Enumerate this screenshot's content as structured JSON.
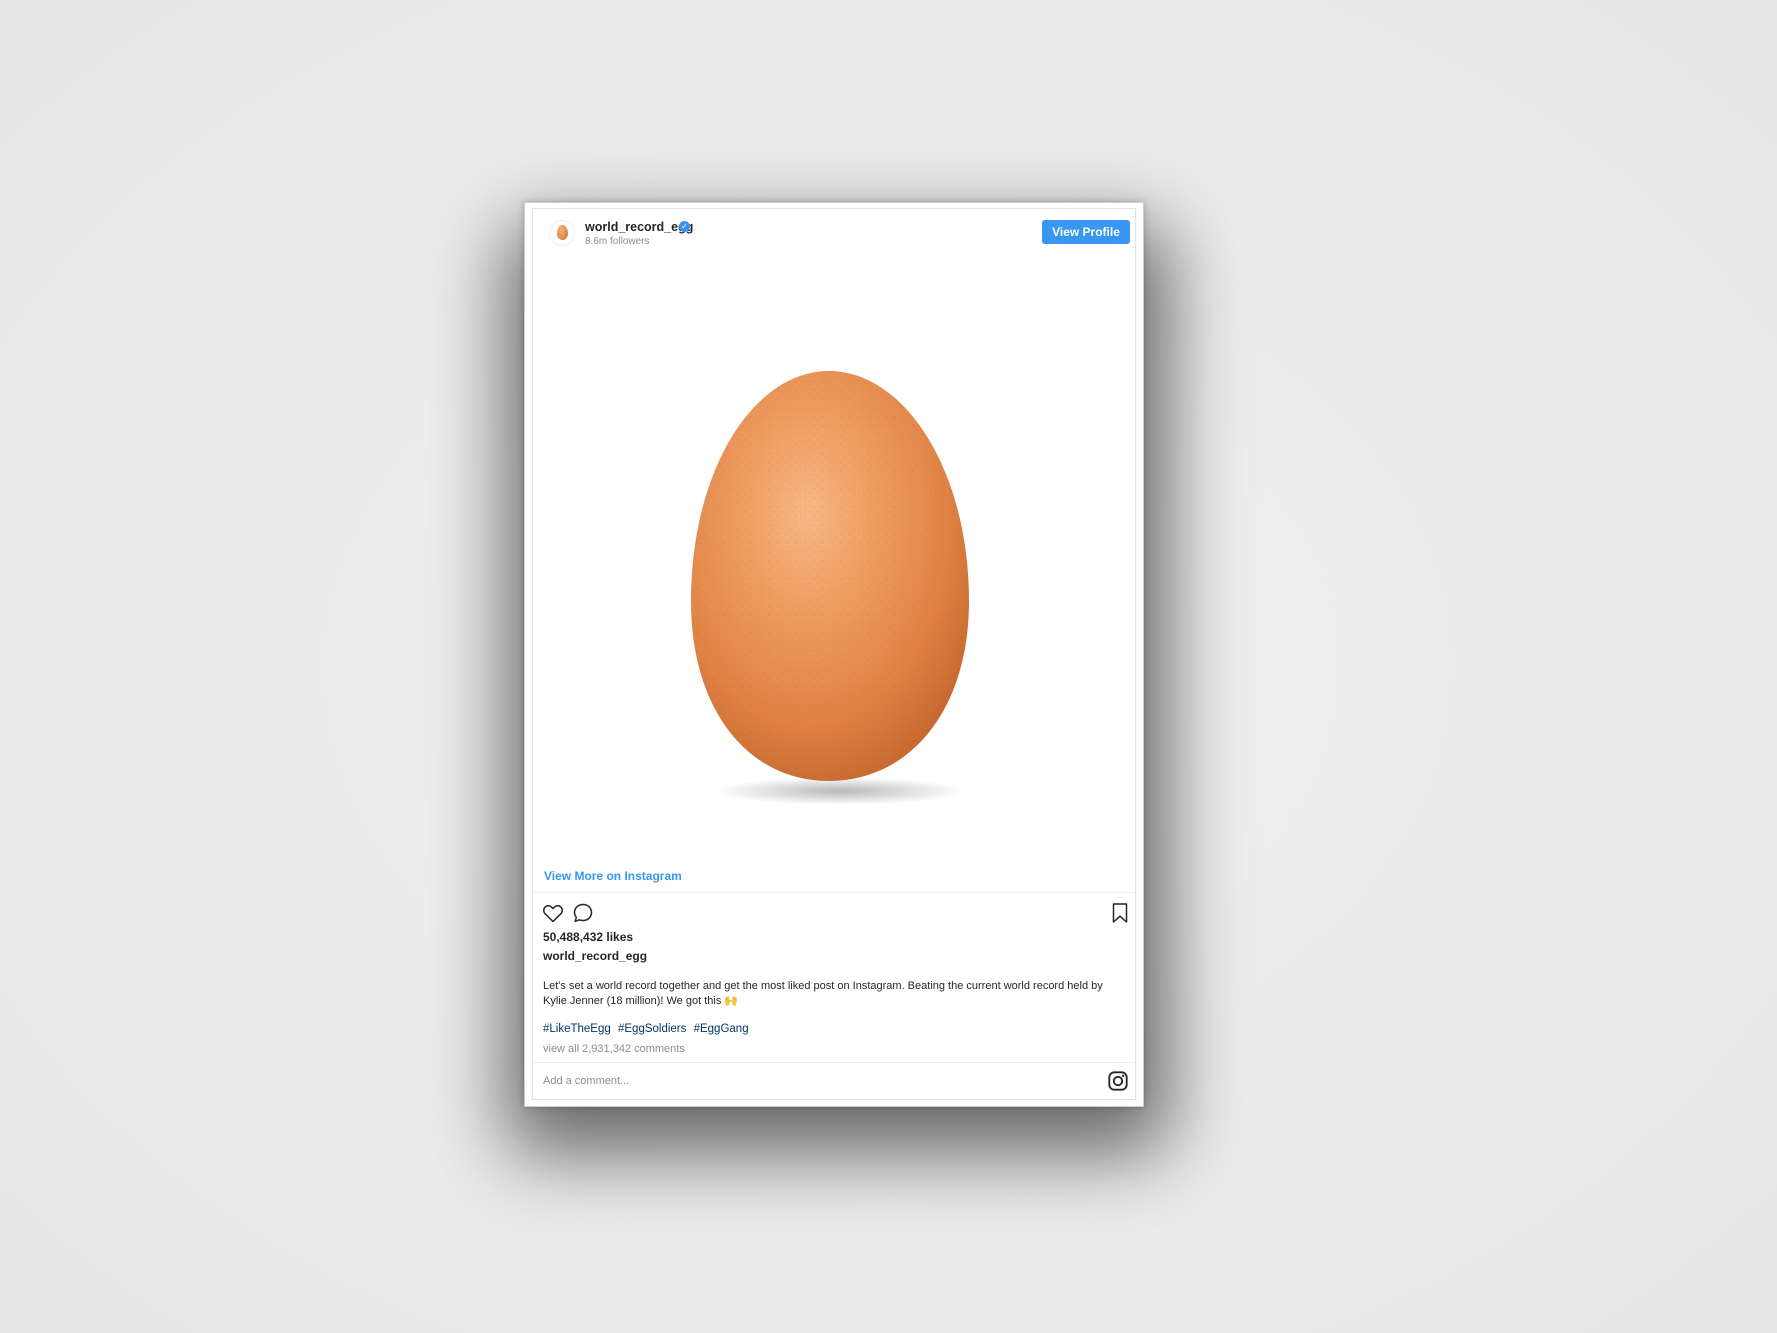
{
  "post": {
    "username": "world_record_egg",
    "followers": "8.6m followers",
    "view_profile_label": "View Profile",
    "view_more_label": "View More on Instagram",
    "likes": "50,488,432 likes",
    "caption_user": "world_record_egg",
    "caption": "Let's set a world record together and get the most liked post on Instagram. Beating the current world record held by Kylie Jenner (18 million)! We got this 🙌",
    "hashtags": [
      "#LikeTheEgg",
      "#EggSoldiers",
      "#EggGang"
    ],
    "view_comments": "view all 2,931,342 comments",
    "comment_placeholder": "Add a comment..."
  },
  "icons": {
    "verified": "verified-badge-icon",
    "like": "heart-icon",
    "comment": "comment-bubble-icon",
    "save": "bookmark-icon",
    "brand": "instagram-logo-icon"
  },
  "colors": {
    "accent": "#3897f0",
    "hashtag": "#003569",
    "text": "#262626",
    "muted": "#8e8e8e",
    "background": "#ececec"
  }
}
